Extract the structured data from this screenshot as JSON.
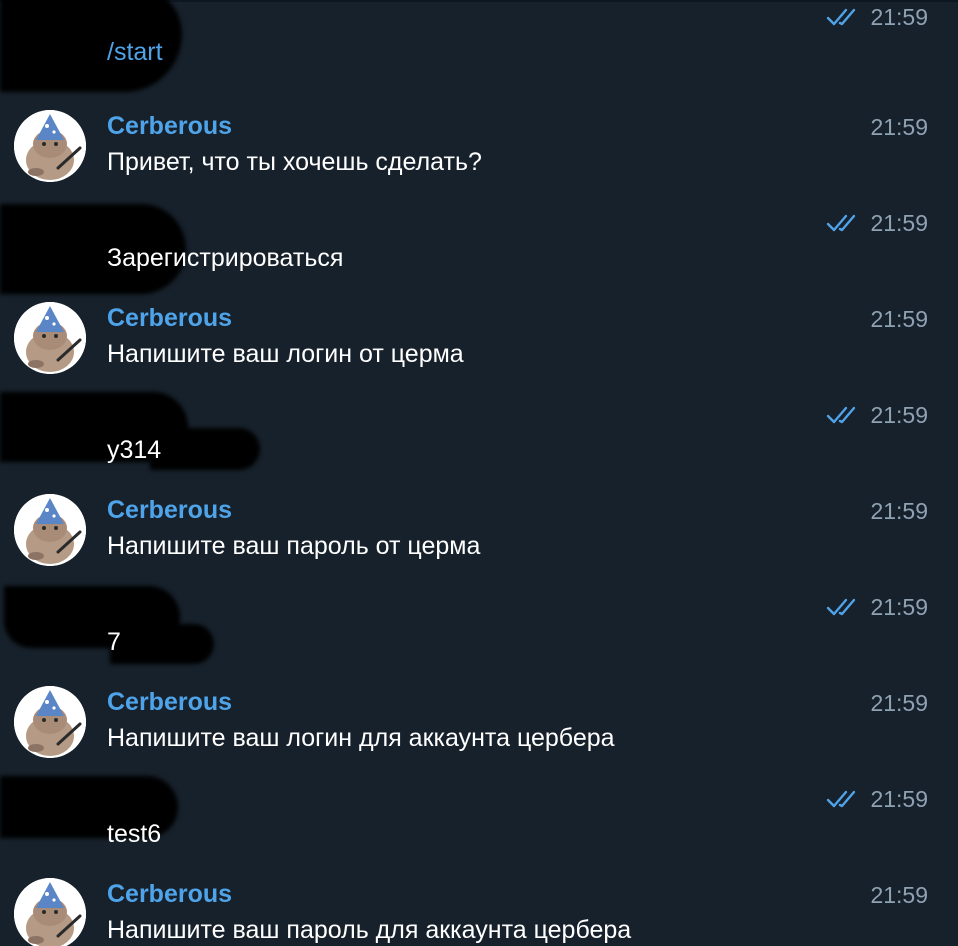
{
  "colors": {
    "background": "#17212b",
    "sender_name": "#4fa4e9",
    "link": "#4fa4e9",
    "time": "#8ea2b4",
    "read_checks": "#4fa4e9",
    "redaction": "#000000"
  },
  "messages": [
    {
      "from": "me",
      "text": "/start",
      "time": "21:59",
      "status_icon": "double-check-icon"
    },
    {
      "from": "bot",
      "sender": "Cerberous",
      "text": "Привет, что ты хочешь сделать?",
      "time": "21:59",
      "avatar_icon": "wizard-cat-avatar"
    },
    {
      "from": "me",
      "text": "Зарегистрироваться",
      "time": "21:59",
      "status_icon": "double-check-icon"
    },
    {
      "from": "bot",
      "sender": "Cerberous",
      "text": "Напишите ваш логин от церма",
      "time": "21:59",
      "avatar_icon": "wizard-cat-avatar"
    },
    {
      "from": "me",
      "text": "y314",
      "time": "21:59",
      "status_icon": "double-check-icon"
    },
    {
      "from": "bot",
      "sender": "Cerberous",
      "text": "Напишите ваш пароль от церма",
      "time": "21:59",
      "avatar_icon": "wizard-cat-avatar"
    },
    {
      "from": "me",
      "text": "7",
      "time": "21:59",
      "status_icon": "double-check-icon"
    },
    {
      "from": "bot",
      "sender": "Cerberous",
      "text": "Напишите ваш логин для аккаунта цербера",
      "time": "21:59",
      "avatar_icon": "wizard-cat-avatar"
    },
    {
      "from": "me",
      "text": "test6",
      "time": "21:59",
      "status_icon": "double-check-icon"
    },
    {
      "from": "bot",
      "sender": "Cerberous",
      "text": "Напишите ваш пароль для аккаунта цербера",
      "time": "21:59",
      "avatar_icon": "wizard-cat-avatar"
    }
  ]
}
